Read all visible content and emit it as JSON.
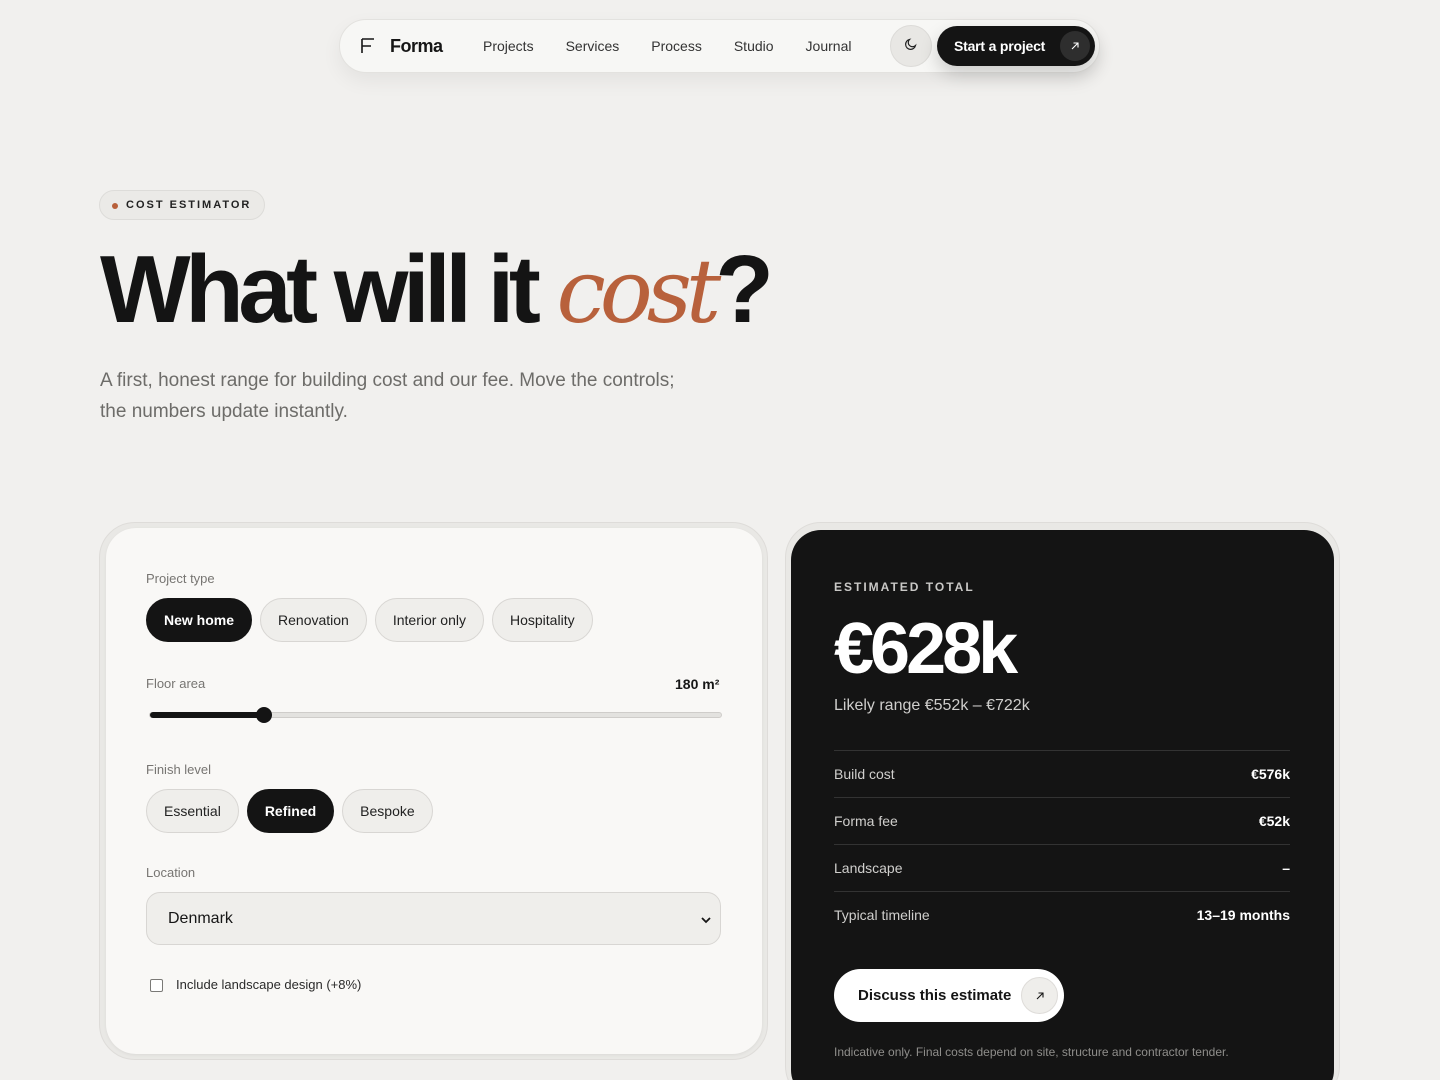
{
  "nav": {
    "brand": "Forma",
    "links": [
      "Projects",
      "Services",
      "Process",
      "Studio",
      "Journal"
    ],
    "cta_label": "Start a project"
  },
  "hero": {
    "eyebrow": "COST ESTIMATOR",
    "title_part1": "What will it ",
    "title_accent": "cost",
    "title_part2": "?",
    "subtitle": "A first, honest range for building cost and our fee. Move the controls; the numbers update instantly."
  },
  "estimator": {
    "project_type_label": "Project type",
    "project_types": [
      "New home",
      "Renovation",
      "Interior only",
      "Hospitality"
    ],
    "project_type_selected": "New home",
    "floor_area_label": "Floor area",
    "floor_area_value": "180 m²",
    "floor_area_fraction": 0.2,
    "finish_label": "Finish level",
    "finishes": [
      "Essential",
      "Refined",
      "Bespoke"
    ],
    "finish_selected": "Refined",
    "location_label": "Location",
    "location_value": "Denmark",
    "landscape_label": "Include landscape design (+8%)",
    "landscape_checked": false
  },
  "result": {
    "label": "ESTIMATED TOTAL",
    "total": "€628k",
    "range": "Likely range €552k – €722k",
    "rows": [
      {
        "label": "Build cost",
        "value": "€576k"
      },
      {
        "label": "Forma fee",
        "value": "€52k"
      },
      {
        "label": "Landscape",
        "value": "–"
      },
      {
        "label": "Typical timeline",
        "value": "13–19 months"
      }
    ],
    "cta_label": "Discuss this estimate",
    "disclaimer": "Indicative only. Final costs depend on site, structure and contractor tender."
  },
  "colors": {
    "accent": "#b8613c",
    "dark": "#141414",
    "background": "#f1f0ee"
  },
  "icons": {
    "theme": "moon-icon",
    "arrow": "arrow-up-right-icon",
    "chevron": "chevron-down-icon"
  }
}
